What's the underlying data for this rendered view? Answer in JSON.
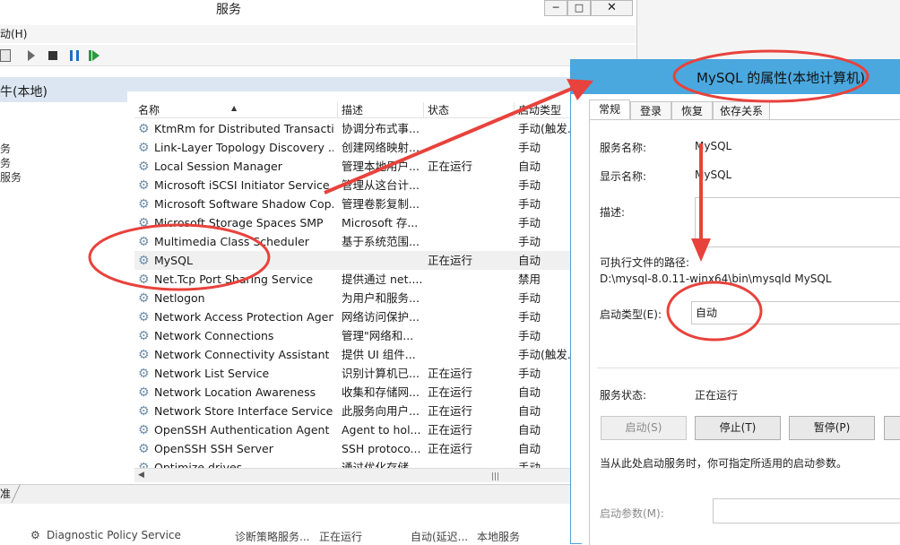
{
  "window": {
    "title": "服务",
    "buttons": {
      "minimize": "─",
      "maximize": "□",
      "close": "✕"
    }
  },
  "menu": {
    "action": "动(H)"
  },
  "left_panel": {
    "title": "牛(本地)",
    "fragments": [
      "务",
      "务",
      "服务"
    ]
  },
  "list": {
    "columns": [
      "名称",
      "描述",
      "状态",
      "启动类型"
    ],
    "rows": [
      {
        "name": "KtmRm for Distributed Transacti...",
        "desc": "协调分布式事...",
        "status": "",
        "start": "手动(触发..."
      },
      {
        "name": "Link-Layer Topology Discovery ...",
        "desc": "创建网络映射...",
        "status": "",
        "start": "手动"
      },
      {
        "name": "Local Session Manager",
        "desc": "管理本地用户...",
        "status": "正在运行",
        "start": "自动"
      },
      {
        "name": "Microsoft iSCSI Initiator Service",
        "desc": "管理从这台计...",
        "status": "",
        "start": "手动"
      },
      {
        "name": "Microsoft Software Shadow Cop...",
        "desc": "管理卷影复制...",
        "status": "",
        "start": "手动"
      },
      {
        "name": "Microsoft Storage Spaces SMP",
        "desc": "Microsoft 存...",
        "status": "",
        "start": "手动"
      },
      {
        "name": "Multimedia Class Scheduler",
        "desc": "基于系统范围...",
        "status": "",
        "start": "手动"
      },
      {
        "name": "MySQL",
        "desc": "",
        "status": "正在运行",
        "start": "自动"
      },
      {
        "name": "Net.Tcp Port Sharing Service",
        "desc": "提供通过 net....",
        "status": "",
        "start": "禁用"
      },
      {
        "name": "Netlogon",
        "desc": "为用户和服务...",
        "status": "",
        "start": "手动"
      },
      {
        "name": "Network Access Protection Agent",
        "desc": "网络访问保护...",
        "status": "",
        "start": "手动"
      },
      {
        "name": "Network Connections",
        "desc": "管理\"网络和...",
        "status": "",
        "start": "手动"
      },
      {
        "name": "Network Connectivity Assistant",
        "desc": "提供 UI 组件...",
        "status": "",
        "start": "手动(触发..."
      },
      {
        "name": "Network List Service",
        "desc": "识别计算机已...",
        "status": "正在运行",
        "start": "手动"
      },
      {
        "name": "Network Location Awareness",
        "desc": "收集和存储网...",
        "status": "正在运行",
        "start": "自动"
      },
      {
        "name": "Network Store Interface Service",
        "desc": "此服务向用户...",
        "status": "正在运行",
        "start": "自动"
      },
      {
        "name": "OpenSSH Authentication Agent",
        "desc": "Agent to hol...",
        "status": "正在运行",
        "start": "自动"
      },
      {
        "name": "OpenSSH SSH Server",
        "desc": "SSH protoco...",
        "status": "正在运行",
        "start": "自动"
      },
      {
        "name": "Optimize drives",
        "desc": "通过优化存储...",
        "status": "",
        "start": "手动"
      }
    ]
  },
  "tabs": {
    "extended": "准"
  },
  "bottom_row": {
    "name": "Diagnostic Policy Service",
    "desc": "诊断策略服务...",
    "status": "正在运行",
    "start": "自动(延迟...",
    "logon": "本地服务"
  },
  "props": {
    "title": "MySQL 的属性(本地计算机)",
    "tabs": [
      "常规",
      "登录",
      "恢复",
      "依存关系"
    ],
    "service_name_label": "服务名称:",
    "service_name": "MySQL",
    "display_name_label": "显示名称:",
    "display_name": "MySQL",
    "description_label": "描述:",
    "exe_path_label": "可执行文件的路径:",
    "exe_path": "D:\\mysql-8.0.11-winx64\\bin\\mysqld MySQL",
    "startup_type_label": "启动类型(E):",
    "startup_type": "自动",
    "status_label": "服务状态:",
    "status": "正在运行",
    "buttons": {
      "start": "启动(S)",
      "stop": "停止(T)",
      "pause": "暂停(P)"
    },
    "hint": "当从此处启动服务时，你可指定所适用的启动参数。",
    "param_label": "启动参数(M):"
  },
  "colors": {
    "accent": "#4aa8de",
    "annotation": "#e8423c"
  },
  "icons": {
    "service": "gear-icon"
  }
}
